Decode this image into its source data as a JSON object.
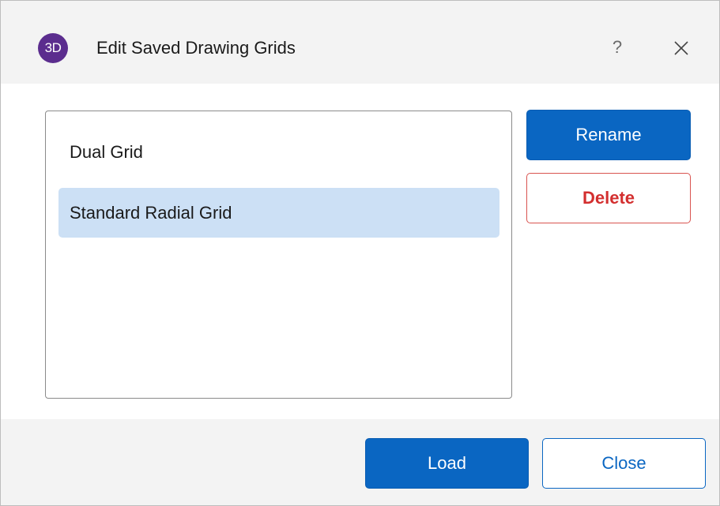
{
  "dialog": {
    "title": "Edit Saved Drawing Grids",
    "app_icon_text": "3D",
    "help_label": "?",
    "close_icon": "close-icon"
  },
  "grid_list": {
    "items": [
      {
        "label": "Dual Grid",
        "selected": false
      },
      {
        "label": "Standard Radial Grid",
        "selected": true
      }
    ]
  },
  "side_buttons": {
    "rename_label": "Rename",
    "delete_label": "Delete"
  },
  "footer": {
    "load_label": "Load",
    "close_label": "Close"
  },
  "colors": {
    "primary": "#0a66c2",
    "danger": "#d32f2f",
    "selection": "#cce0f5",
    "app_icon": "#5b2d8e"
  }
}
